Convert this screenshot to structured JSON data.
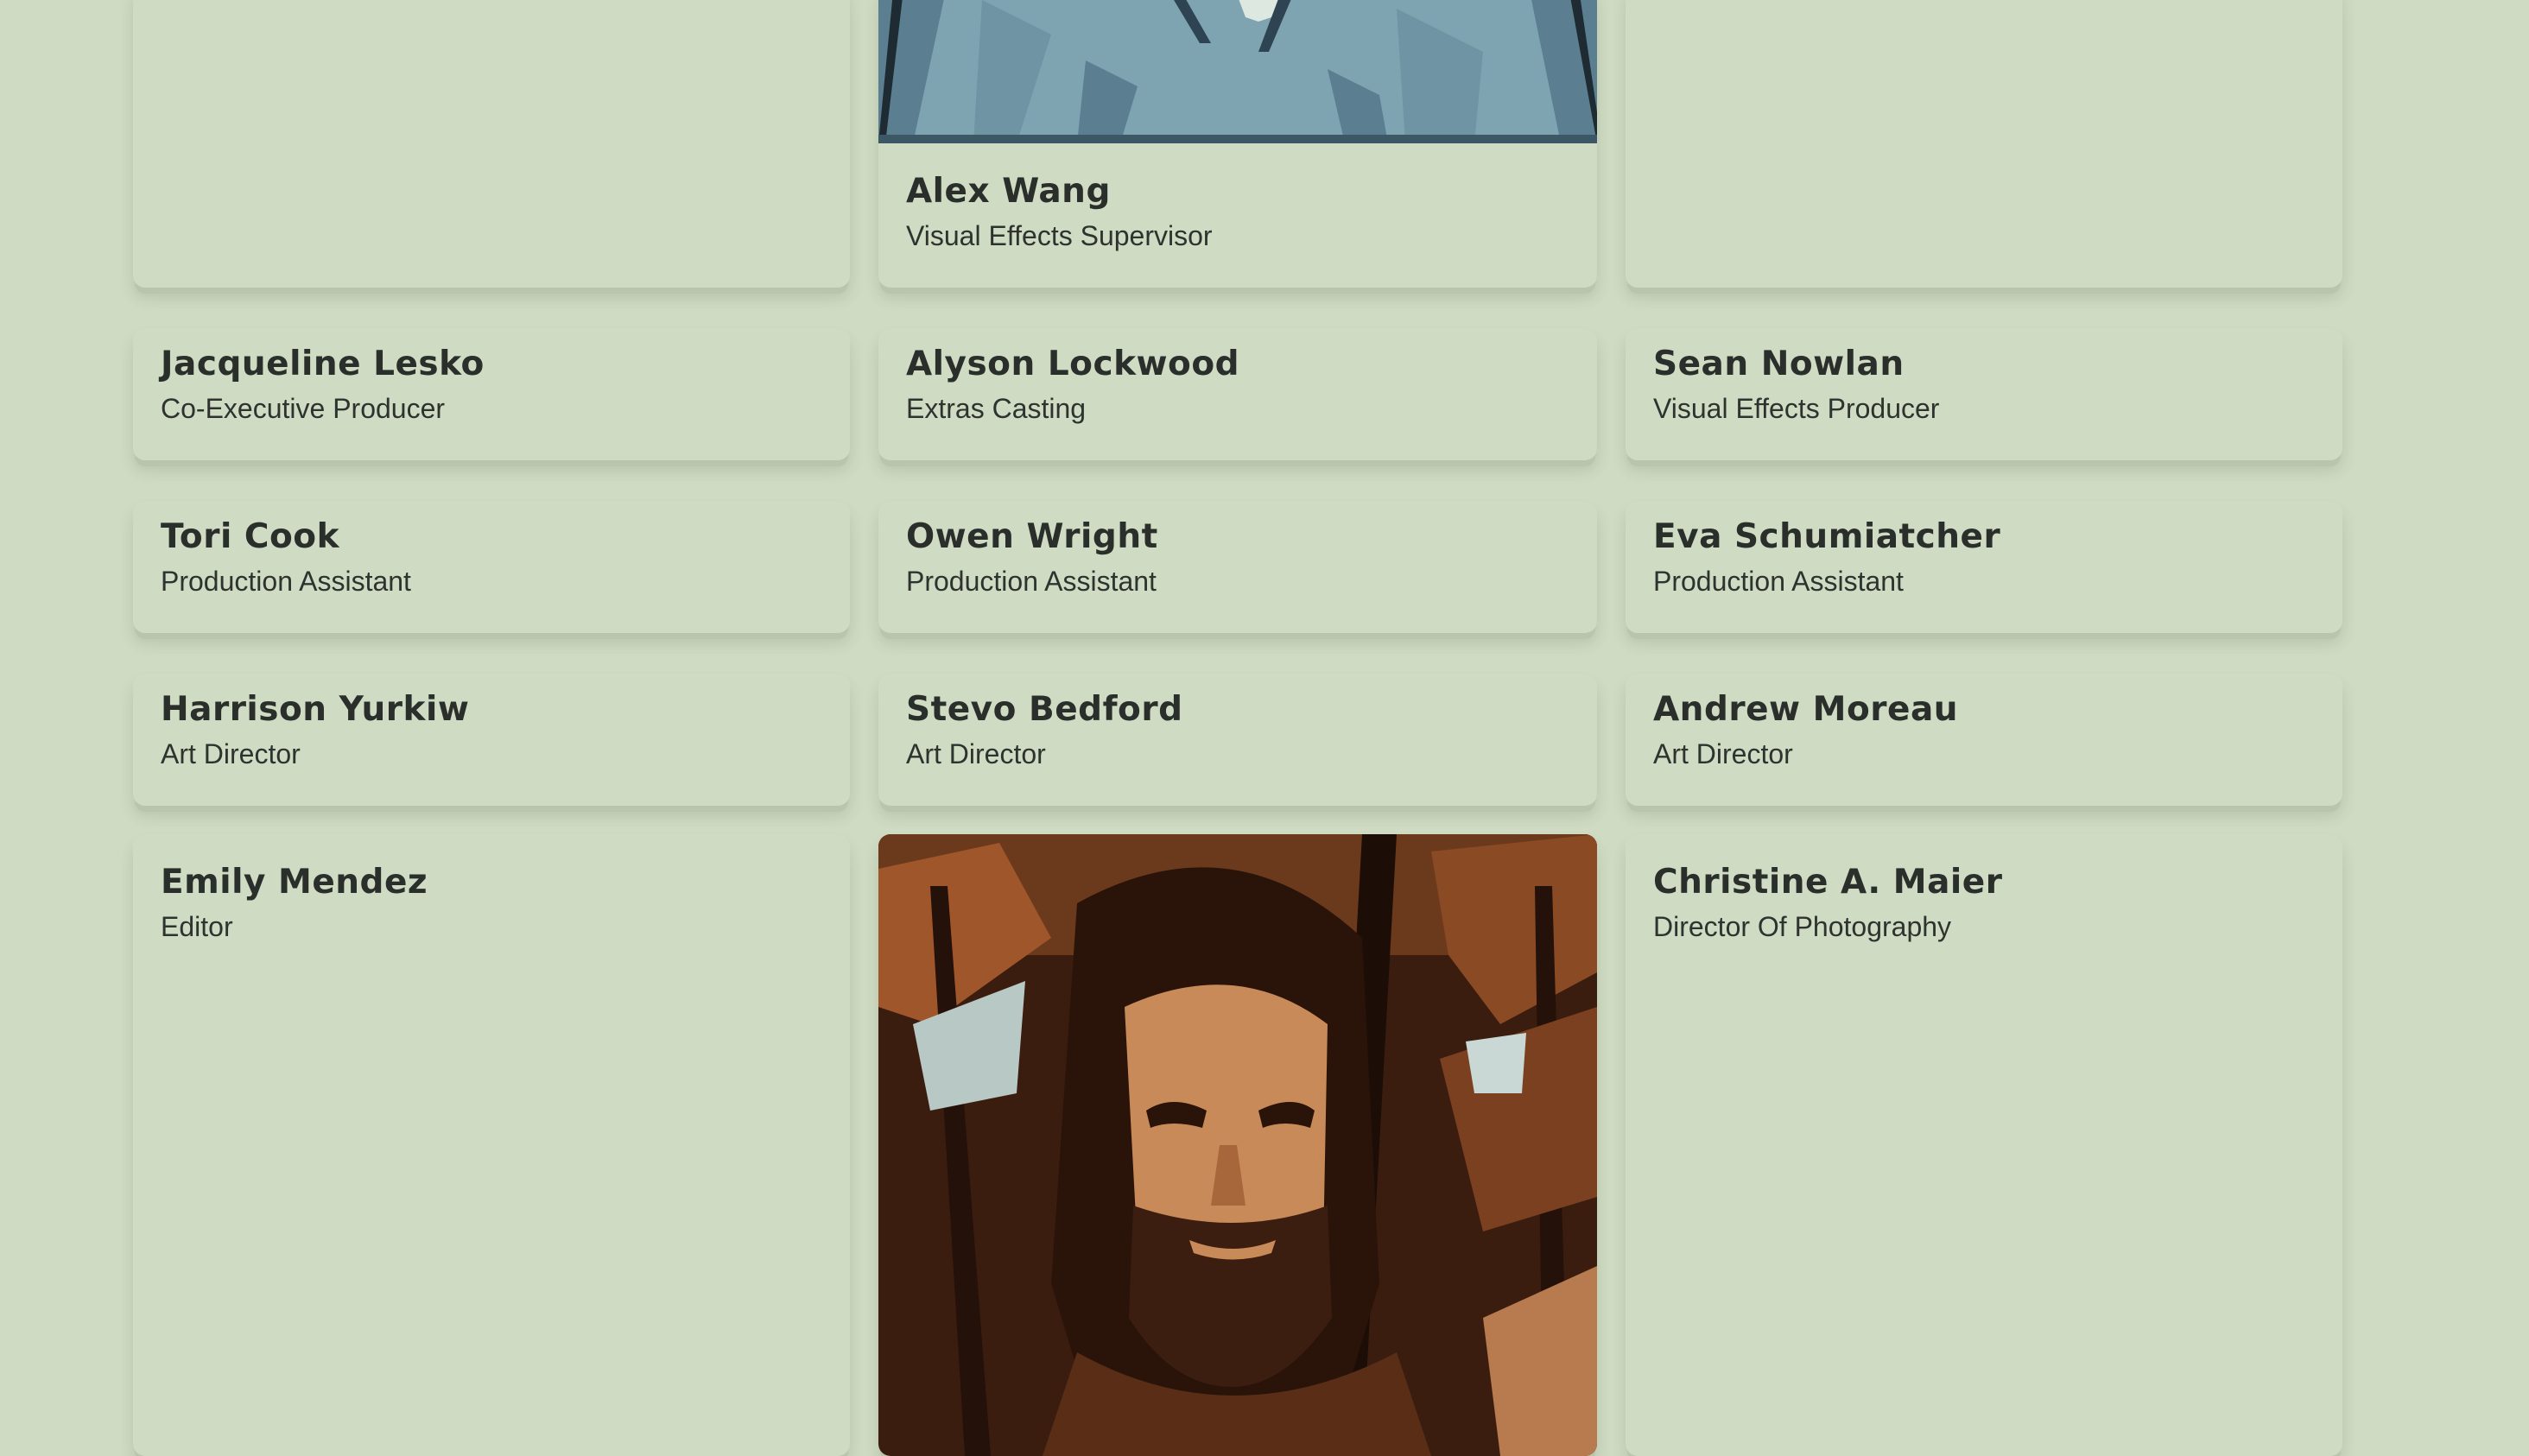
{
  "crew": [
    {
      "name": "Alex Wang",
      "role": "Visual Effects Supervisor"
    },
    {
      "name": "Jacqueline Lesko",
      "role": "Co-Executive Producer"
    },
    {
      "name": "Alyson Lockwood",
      "role": "Extras Casting"
    },
    {
      "name": "Sean Nowlan",
      "role": "Visual Effects Producer"
    },
    {
      "name": "Tori Cook",
      "role": "Production Assistant"
    },
    {
      "name": "Owen Wright",
      "role": "Production Assistant"
    },
    {
      "name": "Eva Schumiatcher",
      "role": "Production Assistant"
    },
    {
      "name": "Harrison Yurkiw",
      "role": "Art Director"
    },
    {
      "name": "Stevo Bedford",
      "role": "Art Director"
    },
    {
      "name": "Andrew Moreau",
      "role": "Art Director"
    },
    {
      "name": "Emily Mendez",
      "role": "Editor"
    },
    {
      "name": "Christine A. Maier",
      "role": "Director Of Photography"
    }
  ],
  "colors": {
    "background": "#cfdbc2",
    "text": "#2b2f2b",
    "card_shadow": "#b9c6ad"
  }
}
